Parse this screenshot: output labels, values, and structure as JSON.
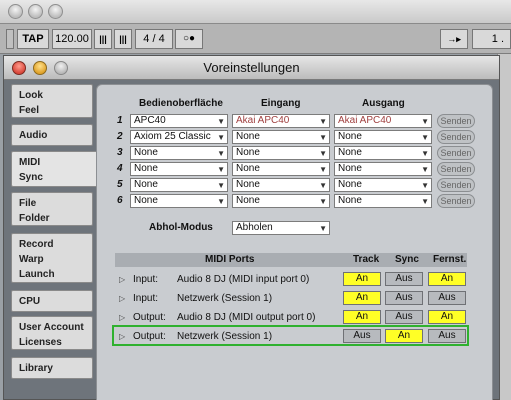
{
  "host": {
    "tap_label": "TAP",
    "tempo": "120.00",
    "meter": "4 / 4",
    "right_value": "1 ."
  },
  "window": {
    "title": "Voreinstellungen"
  },
  "sidebar": {
    "tabs": [
      {
        "lines": [
          "Look",
          "Feel"
        ]
      },
      {
        "lines": [
          "Audio"
        ]
      },
      {
        "lines": [
          "MIDI",
          "Sync"
        ]
      },
      {
        "lines": [
          "File",
          "Folder"
        ]
      },
      {
        "lines": [
          "Record",
          "Warp",
          "Launch"
        ]
      },
      {
        "lines": [
          "CPU"
        ]
      },
      {
        "lines": [
          "User Account",
          "Licenses"
        ]
      },
      {
        "lines": [
          "Library"
        ]
      }
    ]
  },
  "midi": {
    "headers": {
      "surface": "Bedienoberfläche",
      "input": "Eingang",
      "output": "Ausgang"
    },
    "send_label": "Senden",
    "rows": [
      {
        "num": "1",
        "surface": "APC40",
        "input": "Akai APC40",
        "output": "Akai APC40"
      },
      {
        "num": "2",
        "surface": "Axiom 25 Classic",
        "input": "None",
        "output": "None"
      },
      {
        "num": "3",
        "surface": "None",
        "input": "None",
        "output": "None"
      },
      {
        "num": "4",
        "surface": "None",
        "input": "None",
        "output": "None"
      },
      {
        "num": "5",
        "surface": "None",
        "input": "None",
        "output": "None"
      },
      {
        "num": "6",
        "surface": "None",
        "input": "None",
        "output": "None"
      }
    ],
    "takeover_label": "Abhol-Modus",
    "takeover_value": "Abholen"
  },
  "ports": {
    "headers": {
      "ports": "MIDI Ports",
      "track": "Track",
      "sync": "Sync",
      "remote": "Fernst."
    },
    "rows": [
      {
        "dir": "Input:",
        "name": "Audio 8 DJ (MIDI input port 0)",
        "track": "An",
        "sync": "Aus",
        "remote": "An"
      },
      {
        "dir": "Input:",
        "name": "Netzwerk (Session 1)",
        "track": "An",
        "sync": "Aus",
        "remote": "Aus"
      },
      {
        "dir": "Output:",
        "name": "Audio 8 DJ (MIDI output port 0)",
        "track": "An",
        "sync": "Aus",
        "remote": "An"
      },
      {
        "dir": "Output:",
        "name": "Netzwerk (Session 1)",
        "track": "Aus",
        "sync": "An",
        "remote": "Aus"
      }
    ]
  },
  "colors": {
    "toggle_on": "#ffff26",
    "toggle_off": "#b7babe",
    "highlight": "#2fb12f"
  }
}
